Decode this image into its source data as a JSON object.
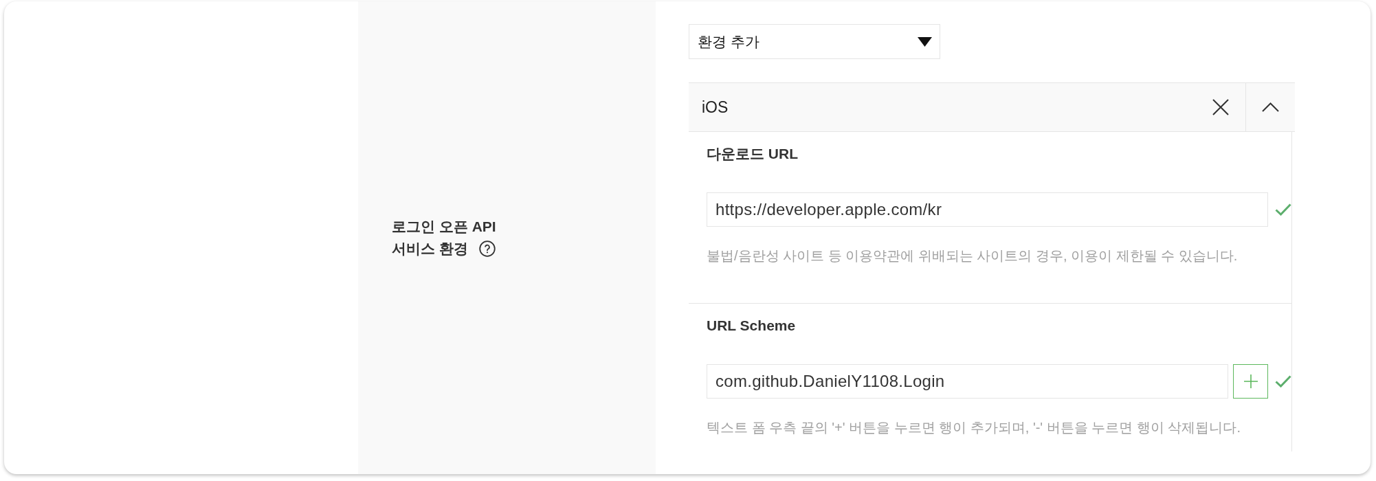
{
  "setting": {
    "label_lines": [
      "로그인 오픈 API",
      "서비스 환경"
    ]
  },
  "environment_select": {
    "value": "환경 추가"
  },
  "environments": [
    {
      "name": "iOS",
      "expanded": true,
      "fields": [
        {
          "kind": "single",
          "label": "다운로드 URL",
          "value": "https://developer.apple.com/kr",
          "valid": true,
          "hint": "불법/음란성 사이트 등 이용약관에 위배되는 사이트의 경우, 이용이 제한될 수 있습니다."
        },
        {
          "kind": "multi",
          "label": "URL Scheme",
          "value": "com.github.DanielY1108.Login",
          "valid": true,
          "hint": "텍스트 폼 우측 끝의 '+' 버튼을 누르면 행이 추가되며, '-' 버튼을 누르면 행이 삭제됩니다."
        }
      ]
    }
  ]
}
